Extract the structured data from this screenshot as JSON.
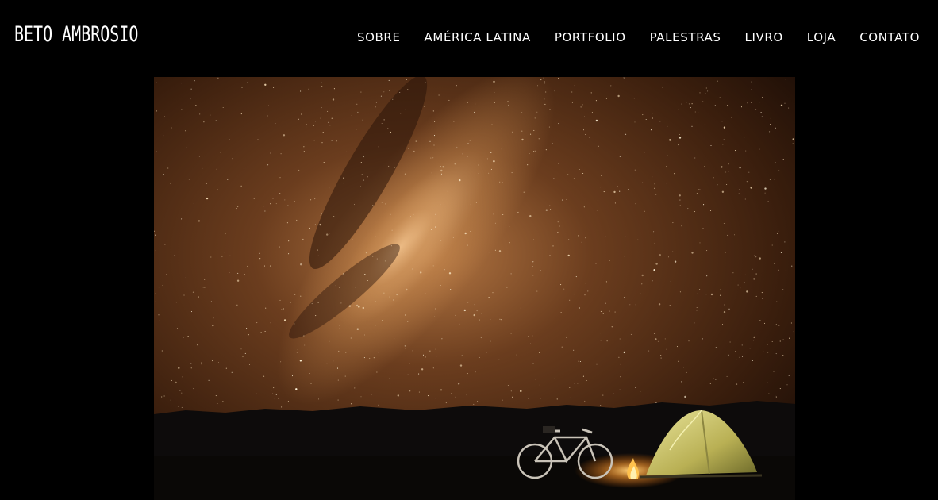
{
  "header": {
    "logo_text": "BETO AMBROSIO",
    "nav": [
      {
        "label": "SOBRE"
      },
      {
        "label": "AMÉRICA LATINA"
      },
      {
        "label": "PORTFOLIO"
      },
      {
        "label": "PALESTRAS"
      },
      {
        "label": "LIVRO"
      },
      {
        "label": "LOJA"
      },
      {
        "label": "CONTATO"
      }
    ]
  },
  "hero": {
    "icon": "night-sky-camp-photo",
    "colors": {
      "sky_core": "#c78a4f",
      "sky_mid": "#5a3318",
      "sky_edge": "#1e0f07",
      "mountains": "#0c0a0a",
      "ground": "#0a0806",
      "tent": "#c8c46a",
      "fire": "#ffb040"
    }
  }
}
